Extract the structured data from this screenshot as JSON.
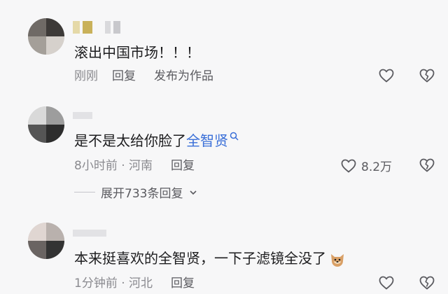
{
  "comments": [
    {
      "text": "滚出中国市场！！！",
      "time": "刚刚",
      "reply": "回复",
      "publish": "发布为作品"
    },
    {
      "text_prefix": "是不是太给你脸了",
      "text_link": "全智贤",
      "time": "8小时前",
      "dot": "·",
      "location": "河南",
      "reply": "回复",
      "likes": "8.2万",
      "expand": "展开733条回复"
    },
    {
      "text": "本来挺喜欢的全智贤，一下子滤镜全没了",
      "time": "1分钟前",
      "dot": "·",
      "location": "河北",
      "reply": "回复"
    }
  ],
  "colors": {
    "link": "#3a6fd8",
    "text": "#1d1d1f",
    "muted": "#8a8a8f"
  }
}
